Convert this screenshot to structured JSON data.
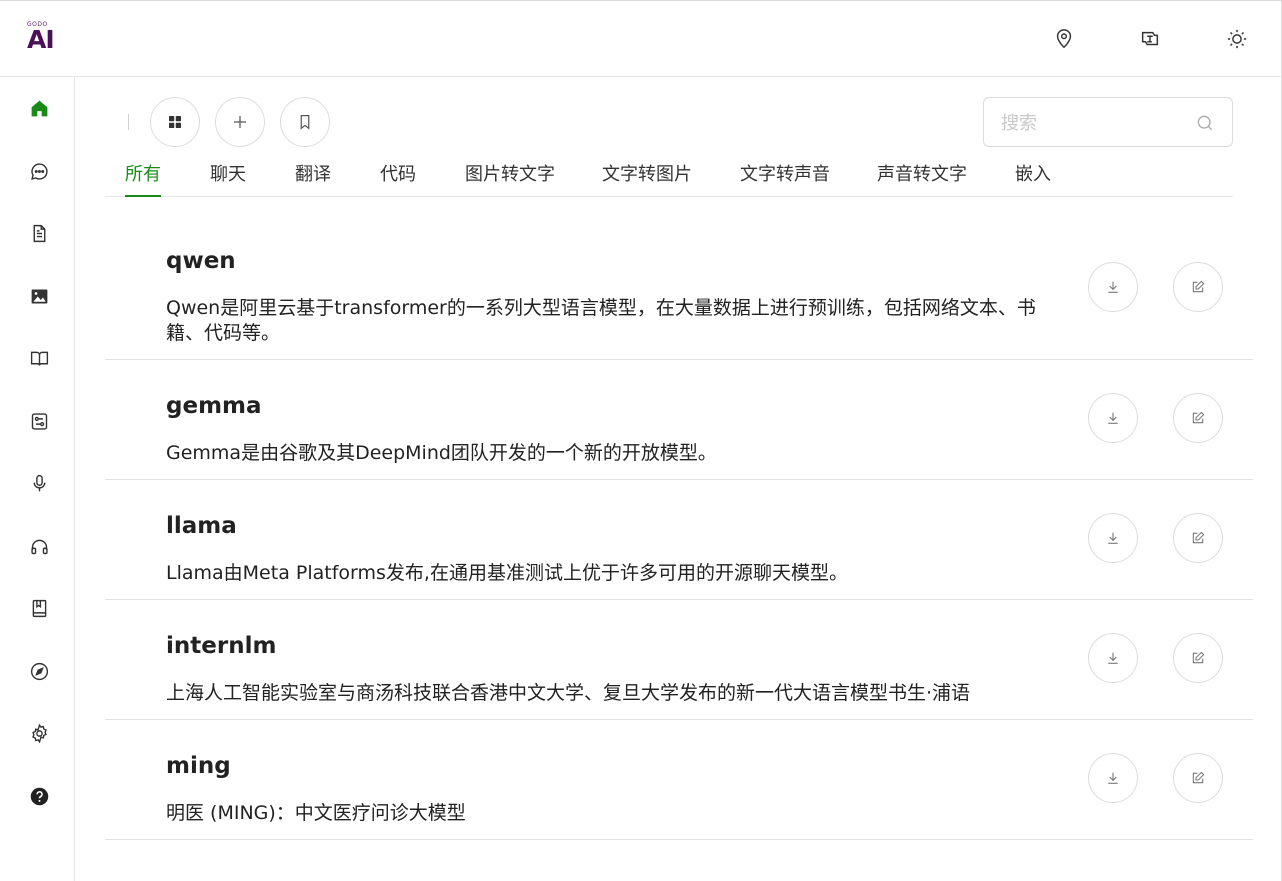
{
  "app": {
    "logo_small": "GODO",
    "logo_big": "AI"
  },
  "header": {
    "icons": [
      "location-icon",
      "translate-icon",
      "sun-icon"
    ]
  },
  "sidebar": {
    "items": [
      "home-icon",
      "chat-icon",
      "document-icon",
      "image-icon",
      "book-icon",
      "settings-panel-icon",
      "microphone-icon",
      "headphones-icon",
      "bookmark-book-icon",
      "compass-icon",
      "gear-icon",
      "help-icon"
    ],
    "active_color": "#1a8a1a"
  },
  "toolbar": {
    "buttons": [
      "grid-icon",
      "plus-icon",
      "bookmark-icon"
    ]
  },
  "search": {
    "placeholder": "搜索",
    "value": ""
  },
  "tabs": [
    {
      "label": "所有",
      "active": true
    },
    {
      "label": "聊天",
      "active": false
    },
    {
      "label": "翻译",
      "active": false
    },
    {
      "label": "代码",
      "active": false
    },
    {
      "label": "图片转文字",
      "active": false
    },
    {
      "label": "文字转图片",
      "active": false
    },
    {
      "label": "文字转声音",
      "active": false
    },
    {
      "label": "声音转文字",
      "active": false
    },
    {
      "label": "嵌入",
      "active": false
    }
  ],
  "models": [
    {
      "name": "qwen",
      "description": "Qwen是阿里云基于transformer的一系列大型语言模型，在大量数据上进行预训练，包括网络文本、书籍、代码等。"
    },
    {
      "name": "gemma",
      "description": "Gemma是由谷歌及其DeepMind团队开发的一个新的开放模型。"
    },
    {
      "name": "llama",
      "description": "Llama由Meta Platforms发布,在通用基准测试上优于许多可用的开源聊天模型。"
    },
    {
      "name": "internlm",
      "description": "上海人工智能实验室与商汤科技联合香港中文大学、复旦大学发布的新一代大语言模型书生·浦语"
    },
    {
      "name": "ming",
      "description": "明医 (MING)：中文医疗问诊大模型"
    }
  ]
}
